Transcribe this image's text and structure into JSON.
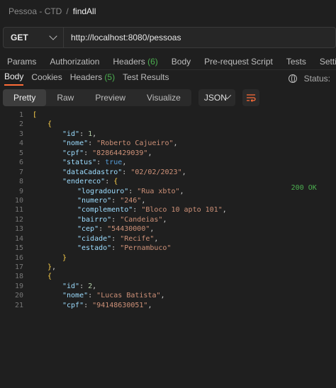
{
  "breadcrumb": {
    "collection": "Pessoa - CTD",
    "separator": "/",
    "request": "findAll"
  },
  "request": {
    "method": "GET",
    "url": "http://localhost:8080/pessoas"
  },
  "request_tabs": [
    {
      "label": "Params",
      "count": ""
    },
    {
      "label": "Authorization",
      "count": ""
    },
    {
      "label": "Headers",
      "count": "(6)"
    },
    {
      "label": "Body",
      "count": ""
    },
    {
      "label": "Pre-request Script",
      "count": ""
    },
    {
      "label": "Tests",
      "count": ""
    },
    {
      "label": "Settings",
      "count": ""
    }
  ],
  "response_tabs": [
    {
      "label": "Body",
      "count": ""
    },
    {
      "label": "Cookies",
      "count": ""
    },
    {
      "label": "Headers",
      "count": "(5)"
    },
    {
      "label": "Test Results",
      "count": ""
    }
  ],
  "status": {
    "label": "Status:",
    "value": "200 OK"
  },
  "view_modes": [
    "Pretty",
    "Raw",
    "Preview",
    "Visualize"
  ],
  "format": "JSON",
  "colors": {
    "accent": "#ff6c37",
    "status_ok": "#4caf50",
    "key": "#9cdcfe",
    "string": "#ce9178"
  },
  "code_lines": [
    {
      "n": "1",
      "indent": 0,
      "tokens": [
        [
          "bracket",
          "["
        ]
      ]
    },
    {
      "n": "2",
      "indent": 1,
      "tokens": [
        [
          "bracket",
          "{"
        ]
      ]
    },
    {
      "n": "3",
      "indent": 2,
      "tokens": [
        [
          "key",
          "\"id\""
        ],
        [
          "p",
          ": "
        ],
        [
          "num",
          "1"
        ],
        [
          "p",
          ","
        ]
      ]
    },
    {
      "n": "4",
      "indent": 2,
      "tokens": [
        [
          "key",
          "\"nome\""
        ],
        [
          "p",
          ": "
        ],
        [
          "str",
          "\"Roberto Cajueiro\""
        ],
        [
          "p",
          ","
        ]
      ]
    },
    {
      "n": "5",
      "indent": 2,
      "tokens": [
        [
          "key",
          "\"cpf\""
        ],
        [
          "p",
          ": "
        ],
        [
          "str",
          "\"82864429039\""
        ],
        [
          "p",
          ","
        ]
      ]
    },
    {
      "n": "6",
      "indent": 2,
      "tokens": [
        [
          "key",
          "\"status\""
        ],
        [
          "p",
          ": "
        ],
        [
          "bool",
          "true"
        ],
        [
          "p",
          ","
        ]
      ]
    },
    {
      "n": "7",
      "indent": 2,
      "tokens": [
        [
          "key",
          "\"dataCadastro\""
        ],
        [
          "p",
          ": "
        ],
        [
          "str",
          "\"02/02/2023\""
        ],
        [
          "p",
          ","
        ]
      ]
    },
    {
      "n": "8",
      "indent": 2,
      "tokens": [
        [
          "key",
          "\"endereco\""
        ],
        [
          "p",
          ": "
        ],
        [
          "bracket",
          "{"
        ]
      ]
    },
    {
      "n": "9",
      "indent": 3,
      "tokens": [
        [
          "key",
          "\"logradouro\""
        ],
        [
          "p",
          ": "
        ],
        [
          "str",
          "\"Rua xbto\""
        ],
        [
          "p",
          ","
        ]
      ]
    },
    {
      "n": "10",
      "indent": 3,
      "tokens": [
        [
          "key",
          "\"numero\""
        ],
        [
          "p",
          ": "
        ],
        [
          "str",
          "\"246\""
        ],
        [
          "p",
          ","
        ]
      ]
    },
    {
      "n": "11",
      "indent": 3,
      "tokens": [
        [
          "key",
          "\"complemento\""
        ],
        [
          "p",
          ": "
        ],
        [
          "str",
          "\"Bloco 10 apto 101\""
        ],
        [
          "p",
          ","
        ]
      ]
    },
    {
      "n": "12",
      "indent": 3,
      "tokens": [
        [
          "key",
          "\"bairro\""
        ],
        [
          "p",
          ": "
        ],
        [
          "str",
          "\"Candeias\""
        ],
        [
          "p",
          ","
        ]
      ]
    },
    {
      "n": "13",
      "indent": 3,
      "tokens": [
        [
          "key",
          "\"cep\""
        ],
        [
          "p",
          ": "
        ],
        [
          "str",
          "\"54430000\""
        ],
        [
          "p",
          ","
        ]
      ]
    },
    {
      "n": "14",
      "indent": 3,
      "tokens": [
        [
          "key",
          "\"cidade\""
        ],
        [
          "p",
          ": "
        ],
        [
          "str",
          "\"Recife\""
        ],
        [
          "p",
          ","
        ]
      ]
    },
    {
      "n": "15",
      "indent": 3,
      "tokens": [
        [
          "key",
          "\"estado\""
        ],
        [
          "p",
          ": "
        ],
        [
          "str",
          "\"Pernambuco\""
        ]
      ]
    },
    {
      "n": "16",
      "indent": 2,
      "tokens": [
        [
          "bracket",
          "}"
        ]
      ]
    },
    {
      "n": "17",
      "indent": 1,
      "tokens": [
        [
          "bracket",
          "}"
        ],
        [
          "p",
          ","
        ]
      ]
    },
    {
      "n": "18",
      "indent": 1,
      "tokens": [
        [
          "bracket",
          "{"
        ]
      ]
    },
    {
      "n": "19",
      "indent": 2,
      "tokens": [
        [
          "key",
          "\"id\""
        ],
        [
          "p",
          ": "
        ],
        [
          "num",
          "2"
        ],
        [
          "p",
          ","
        ]
      ]
    },
    {
      "n": "20",
      "indent": 2,
      "tokens": [
        [
          "key",
          "\"nome\""
        ],
        [
          "p",
          ": "
        ],
        [
          "str",
          "\"Lucas Batista\""
        ],
        [
          "p",
          ","
        ]
      ]
    },
    {
      "n": "21",
      "indent": 2,
      "tokens": [
        [
          "key",
          "\"cpf\""
        ],
        [
          "p",
          ": "
        ],
        [
          "str",
          "\"94148630051\""
        ],
        [
          "p",
          ","
        ]
      ]
    }
  ]
}
